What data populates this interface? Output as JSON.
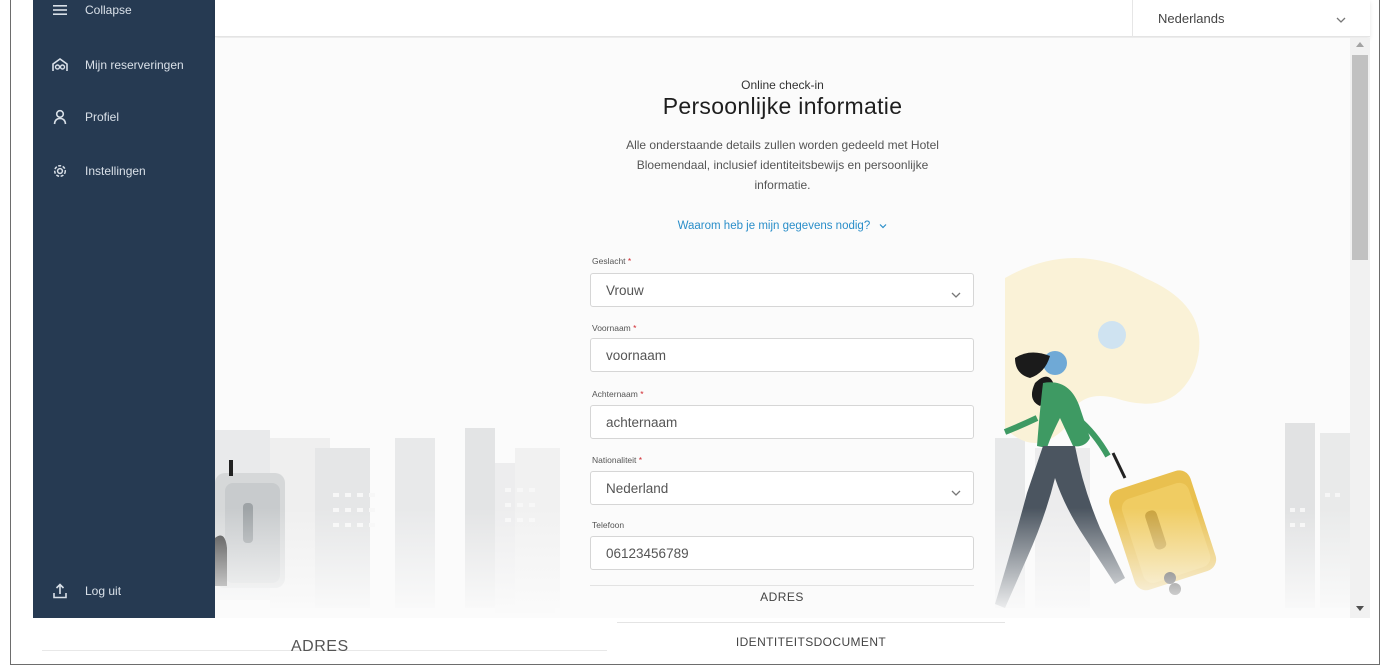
{
  "sidebar": {
    "collapse_label": "Collapse",
    "items": [
      {
        "label": "Mijn reserveringen",
        "icon": "hotel-icon"
      },
      {
        "label": "Profiel",
        "icon": "user-icon"
      },
      {
        "label": "Instellingen",
        "icon": "gear-icon"
      }
    ],
    "logout_label": "Log uit",
    "background": "#263a52"
  },
  "topbar": {
    "language": "Nederlands"
  },
  "main": {
    "kicker": "Online check-in",
    "title": "Persoonlijke informatie",
    "intro": "Alle onderstaande details zullen worden gedeeld met Hotel Bloemendaal, inclusief identiteitsbewijs en persoonlijke informatie.",
    "why_link": "Waarom heb je mijn gegevens nodig?",
    "link_color": "#2a8ec9",
    "fields": {
      "gender": {
        "label": "Geslacht",
        "required": "*",
        "value": "Vrouw"
      },
      "first_name": {
        "label": "Voornaam",
        "required": "*",
        "value": "voornaam"
      },
      "last_name": {
        "label": "Achternaam",
        "required": "*",
        "value": "achternaam"
      },
      "nationality": {
        "label": "Nationaliteit",
        "required": "*",
        "value": "Nederland"
      },
      "phone": {
        "label": "Telefoon",
        "value": "06123456789"
      }
    },
    "section_next": "ADRES"
  },
  "below": {
    "adres_heading": "ADRES",
    "id_heading": "IDENTITEITSDOCUMENT"
  }
}
